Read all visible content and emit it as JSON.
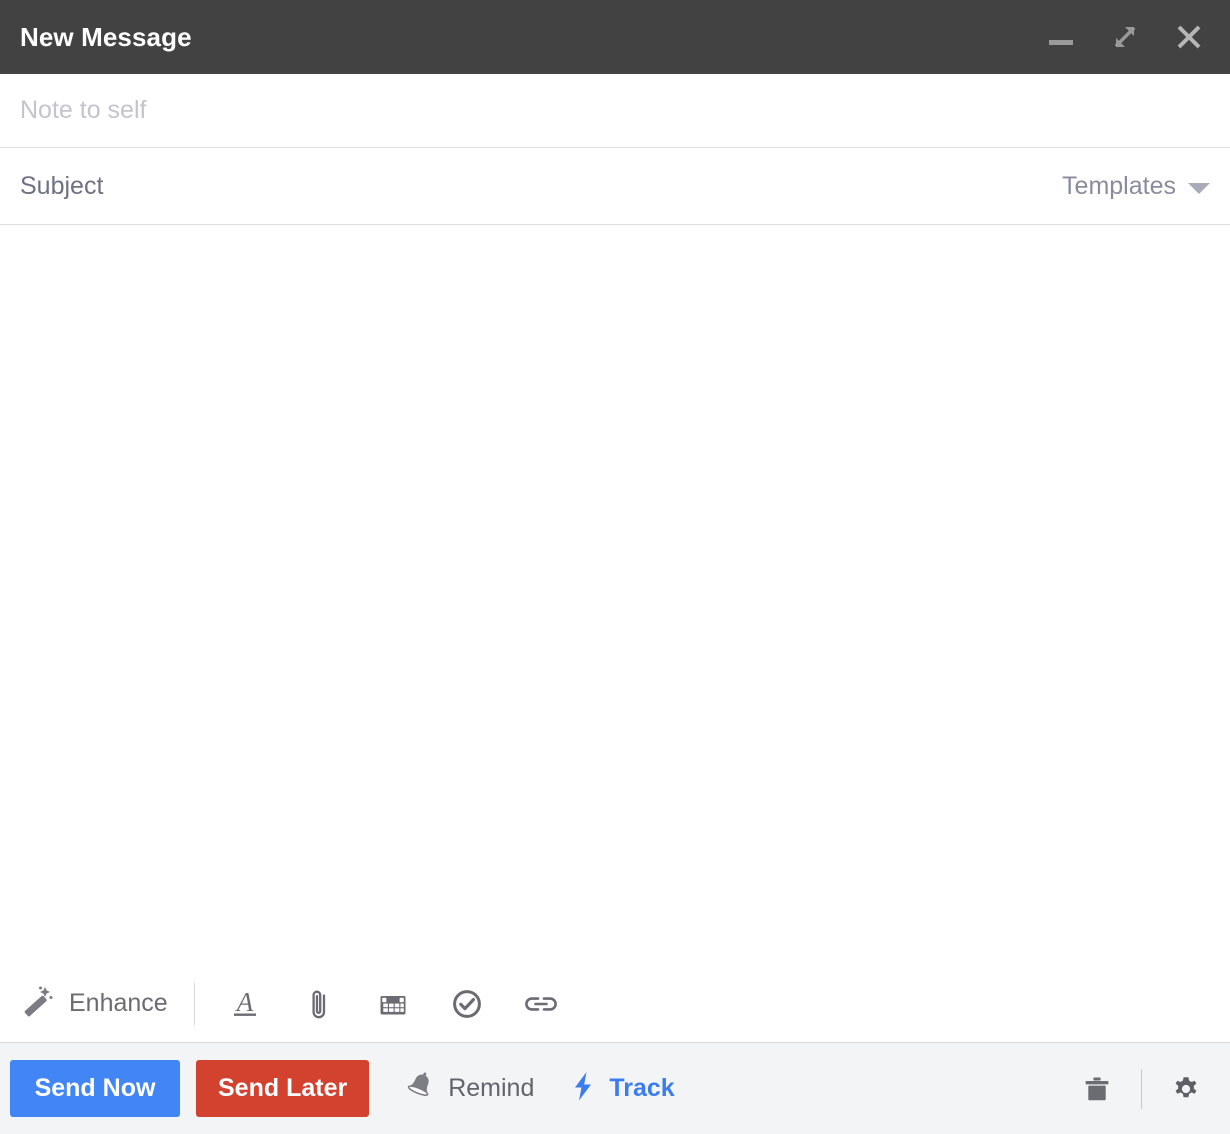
{
  "window": {
    "title": "New Message",
    "titlebar_bg": "#424242",
    "controls": [
      {
        "name": "minimize",
        "label": "Minimize"
      },
      {
        "name": "expand",
        "label": "Expand"
      },
      {
        "name": "close",
        "label": "Close"
      }
    ]
  },
  "fields": {
    "recipient": {
      "value": "",
      "placeholder": "Note to self"
    },
    "subject": {
      "value": "",
      "placeholder": "Subject"
    },
    "body": {
      "value": "",
      "placeholder": ""
    }
  },
  "templates": {
    "label": "Templates",
    "icon": "chevron-down-icon"
  },
  "toolbar": {
    "enhance_label": "Enhance",
    "enhance_icon": "magic-wand-icon",
    "icons": [
      {
        "name": "format-text-icon",
        "title": "Formatting options"
      },
      {
        "name": "attachment-icon",
        "title": "Attach files"
      },
      {
        "name": "calendar-icon",
        "title": "Insert meeting time"
      },
      {
        "name": "check-circle-icon",
        "title": "Insert task"
      },
      {
        "name": "link-icon",
        "title": "Insert link"
      }
    ]
  },
  "actions": {
    "send_now": {
      "label": "Send Now",
      "color": "#4285f4"
    },
    "send_later": {
      "label": "Send Later",
      "color": "#d3412f"
    },
    "remind": {
      "label": "Remind",
      "icon": "bell-icon",
      "color": "#63646b"
    },
    "track": {
      "label": "Track",
      "icon": "bolt-icon",
      "color": "#3b7dec"
    },
    "discard": {
      "name": "trash-icon",
      "title": "Discard draft"
    },
    "settings": {
      "name": "gear-icon",
      "title": "Settings"
    }
  }
}
